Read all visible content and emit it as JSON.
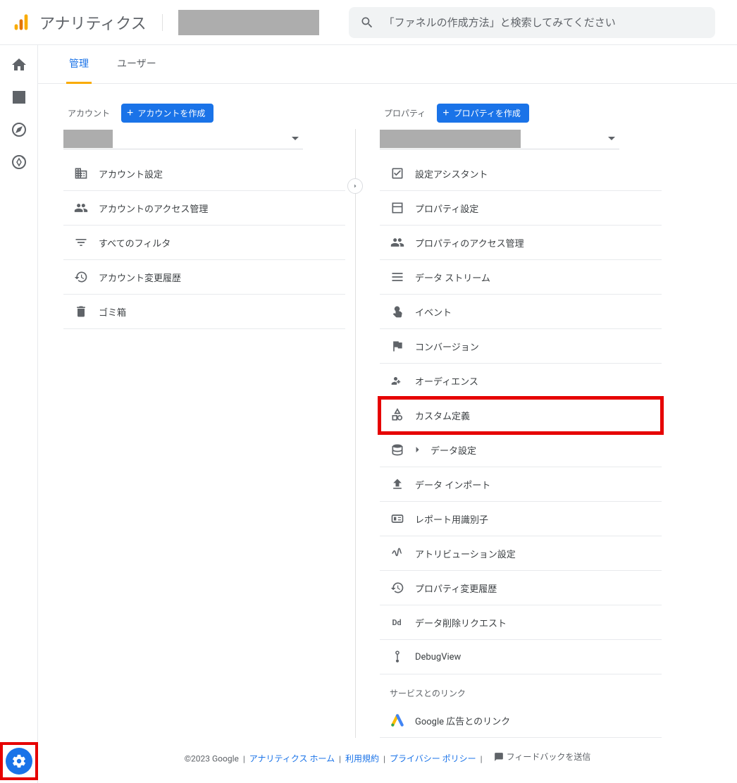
{
  "header": {
    "product_name": "アナリティクス",
    "search_placeholder": "「ファネルの作成方法」と検索してみてください"
  },
  "tabs": [
    {
      "label": "管理",
      "active": true
    },
    {
      "label": "ユーザー",
      "active": false
    }
  ],
  "account_col": {
    "label": "アカウント",
    "create_button": "アカウントを作成",
    "items": [
      {
        "icon": "business",
        "label": "アカウント設定"
      },
      {
        "icon": "people",
        "label": "アカウントのアクセス管理"
      },
      {
        "icon": "filter",
        "label": "すべてのフィルタ"
      },
      {
        "icon": "history",
        "label": "アカウント変更履歴"
      },
      {
        "icon": "trash",
        "label": "ゴミ箱"
      }
    ]
  },
  "property_col": {
    "label": "プロパティ",
    "create_button": "プロパティを作成",
    "items": [
      {
        "icon": "checkbox",
        "label": "設定アシスタント"
      },
      {
        "icon": "layout",
        "label": "プロパティ設定"
      },
      {
        "icon": "people",
        "label": "プロパティのアクセス管理"
      },
      {
        "icon": "stream",
        "label": "データ ストリーム"
      },
      {
        "icon": "touch",
        "label": "イベント"
      },
      {
        "icon": "flag",
        "label": "コンバージョン"
      },
      {
        "icon": "audience",
        "label": "オーディエンス"
      },
      {
        "icon": "shapes",
        "label": "カスタム定義",
        "highlight": true
      },
      {
        "icon": "database",
        "label": "データ設定",
        "expandable": true
      },
      {
        "icon": "upload",
        "label": "データ インポート"
      },
      {
        "icon": "id",
        "label": "レポート用識別子"
      },
      {
        "icon": "attribution",
        "label": "アトリビューション設定"
      },
      {
        "icon": "history",
        "label": "プロパティ変更履歴"
      },
      {
        "icon": "dd",
        "label": "データ削除リクエスト"
      },
      {
        "icon": "debug",
        "label": "DebugView"
      }
    ],
    "section_title": "サービスとのリンク",
    "links": [
      {
        "icon": "ads",
        "label": "Google 広告とのリンク"
      }
    ]
  },
  "footer": {
    "copyright": "©2023 Google",
    "links": [
      {
        "label": "アナリティクス ホーム"
      },
      {
        "label": "利用規約"
      },
      {
        "label": "プライバシー ポリシー"
      }
    ],
    "feedback": "フィードバックを送信"
  }
}
